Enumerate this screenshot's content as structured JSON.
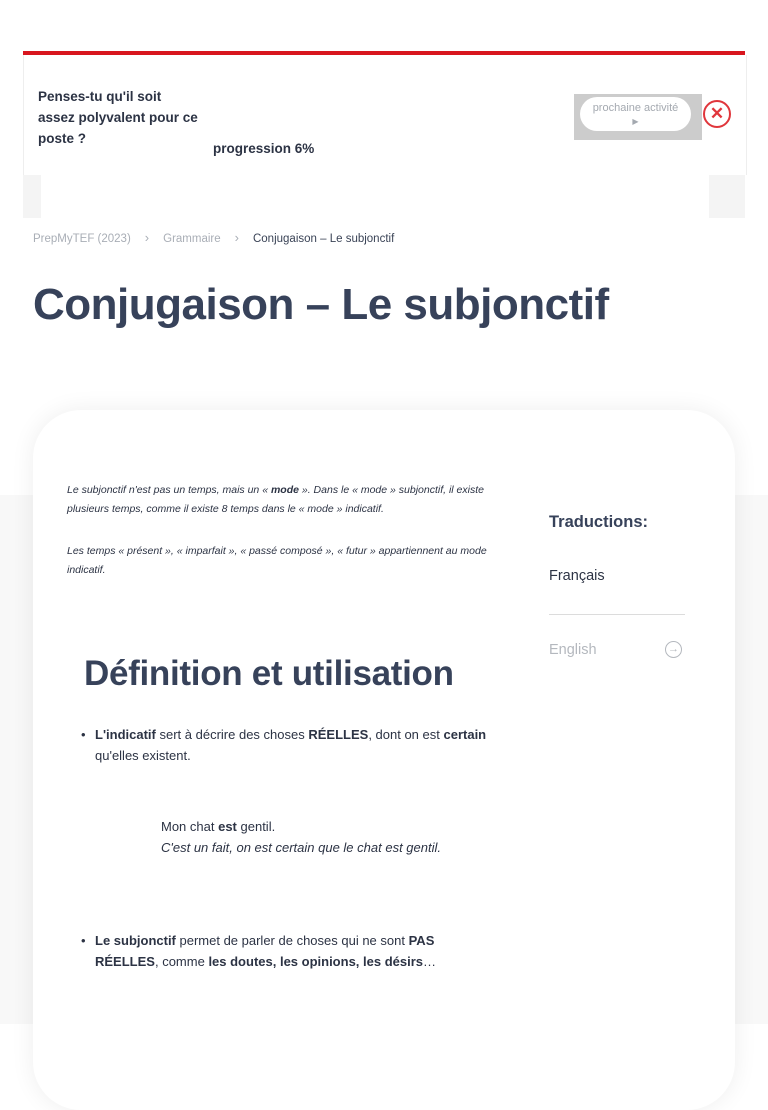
{
  "activity": {
    "question": "Penses-tu qu'il soit assez polyvalent pour ce poste ?",
    "progress": "progression 6%",
    "next_label": "prochaine activité",
    "next_arrow": "▶",
    "close_symbol": "✕"
  },
  "breadcrumb": {
    "items": [
      "PrepMyTEF (2023)",
      "Grammaire",
      "Conjugaison – Le subjonctif"
    ],
    "separator": "›"
  },
  "page_title": "Conjugaison – Le subjonctif",
  "intro": {
    "p1_before": "Le subjonctif n'est pas un temps, mais un « ",
    "p1_bold": "mode",
    "p1_after": " ». Dans le « mode » subjonctif, il existe plusieurs temps, comme il existe 8 temps dans le « mode » indicatif.",
    "p2": "Les temps « présent », « imparfait », « passé composé », « futur » appartiennent au mode indicatif."
  },
  "section": {
    "title": "Définition et utilisation",
    "bullet1": {
      "bold1": "L'indicatif",
      "text1": " sert à décrire des choses ",
      "bold2": "RÉELLES",
      "text2": ", dont on est ",
      "bold3": "certain",
      "text3": " qu'elles existent."
    },
    "example": {
      "before": "Mon chat ",
      "bold": "est",
      "after": " gentil.",
      "note": "C'est un fait, on est certain que le chat est gentil."
    },
    "bullet2": {
      "bold1": "Le subjonctif",
      "text1": " permet de parler de choses qui ne sont ",
      "bold2": "PAS RÉELLES",
      "text2": ", comme ",
      "bold3": "les doutes, les opinions, les désirs",
      "text3": "…"
    }
  },
  "translations": {
    "title": "Traductions:",
    "current": "Français",
    "other": "English",
    "other_icon": "→"
  },
  "colors": {
    "accent": "#d8161e",
    "close": "#e0363c",
    "heading": "#37425a"
  }
}
